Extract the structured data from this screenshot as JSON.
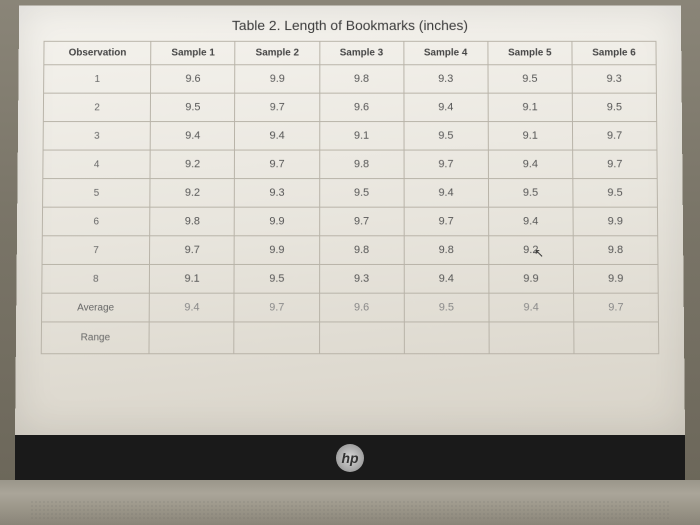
{
  "chart_data": {
    "type": "table",
    "title": "Table 2.  Length of Bookmarks (inches)",
    "columns": [
      "Observation",
      "Sample 1",
      "Sample 2",
      "Sample 3",
      "Sample 4",
      "Sample 5",
      "Sample 6"
    ],
    "rows": [
      {
        "obs": "1",
        "s1": "9.6",
        "s2": "9.9",
        "s3": "9.8",
        "s4": "9.3",
        "s5": "9.5",
        "s6": "9.3"
      },
      {
        "obs": "2",
        "s1": "9.5",
        "s2": "9.7",
        "s3": "9.6",
        "s4": "9.4",
        "s5": "9.1",
        "s6": "9.5"
      },
      {
        "obs": "3",
        "s1": "9.4",
        "s2": "9.4",
        "s3": "9.1",
        "s4": "9.5",
        "s5": "9.1",
        "s6": "9.7"
      },
      {
        "obs": "4",
        "s1": "9.2",
        "s2": "9.7",
        "s3": "9.8",
        "s4": "9.7",
        "s5": "9.4",
        "s6": "9.7"
      },
      {
        "obs": "5",
        "s1": "9.2",
        "s2": "9.3",
        "s3": "9.5",
        "s4": "9.4",
        "s5": "9.5",
        "s6": "9.5"
      },
      {
        "obs": "6",
        "s1": "9.8",
        "s2": "9.9",
        "s3": "9.7",
        "s4": "9.7",
        "s5": "9.4",
        "s6": "9.9"
      },
      {
        "obs": "7",
        "s1": "9.7",
        "s2": "9.9",
        "s3": "9.8",
        "s4": "9.8",
        "s5": "9.2",
        "s6": "9.8"
      },
      {
        "obs": "8",
        "s1": "9.1",
        "s2": "9.5",
        "s3": "9.3",
        "s4": "9.4",
        "s5": "9.9",
        "s6": "9.9"
      }
    ],
    "average": {
      "obs": "Average",
      "s1": "9.4",
      "s2": "9.7",
      "s3": "9.6",
      "s4": "9.5",
      "s5": "9.4",
      "s6": "9.7"
    },
    "range": {
      "obs": "Range",
      "s1": "",
      "s2": "",
      "s3": "",
      "s4": "",
      "s5": "",
      "s6": ""
    }
  },
  "logo": "hp"
}
